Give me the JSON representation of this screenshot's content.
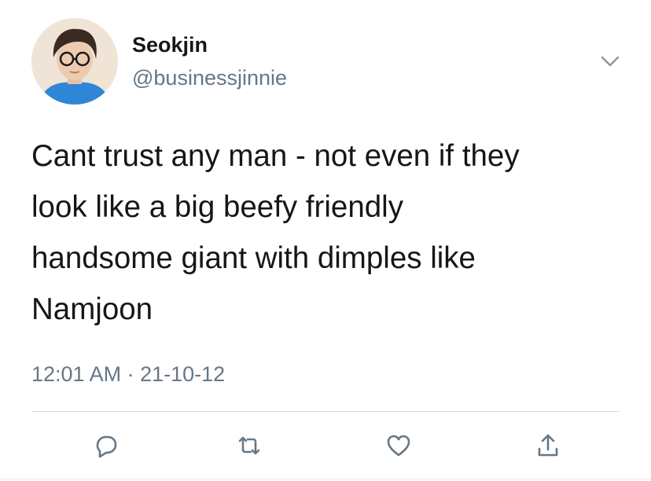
{
  "tweet": {
    "author": {
      "display_name": "Seokjin",
      "handle": "@businessjinnie",
      "avatar_icon": "profile-photo"
    },
    "text": "Cant trust any man - not even if they\nlook like a big beefy friendly\nhandsome giant with dimples like\nNamjoon",
    "timestamp": "12:01 AM · 21-10-12"
  },
  "actions": [
    {
      "name": "reply",
      "icon": "comment-bubble-icon"
    },
    {
      "name": "retweet",
      "icon": "retweet-arrows-icon"
    },
    {
      "name": "like",
      "icon": "heart-icon"
    },
    {
      "name": "share",
      "icon": "share-upload-icon"
    }
  ],
  "colors": {
    "text_primary": "#14171a",
    "text_secondary": "#657786",
    "icon": "#657786",
    "divider": "#d6dadd",
    "background": "#ffffff"
  }
}
